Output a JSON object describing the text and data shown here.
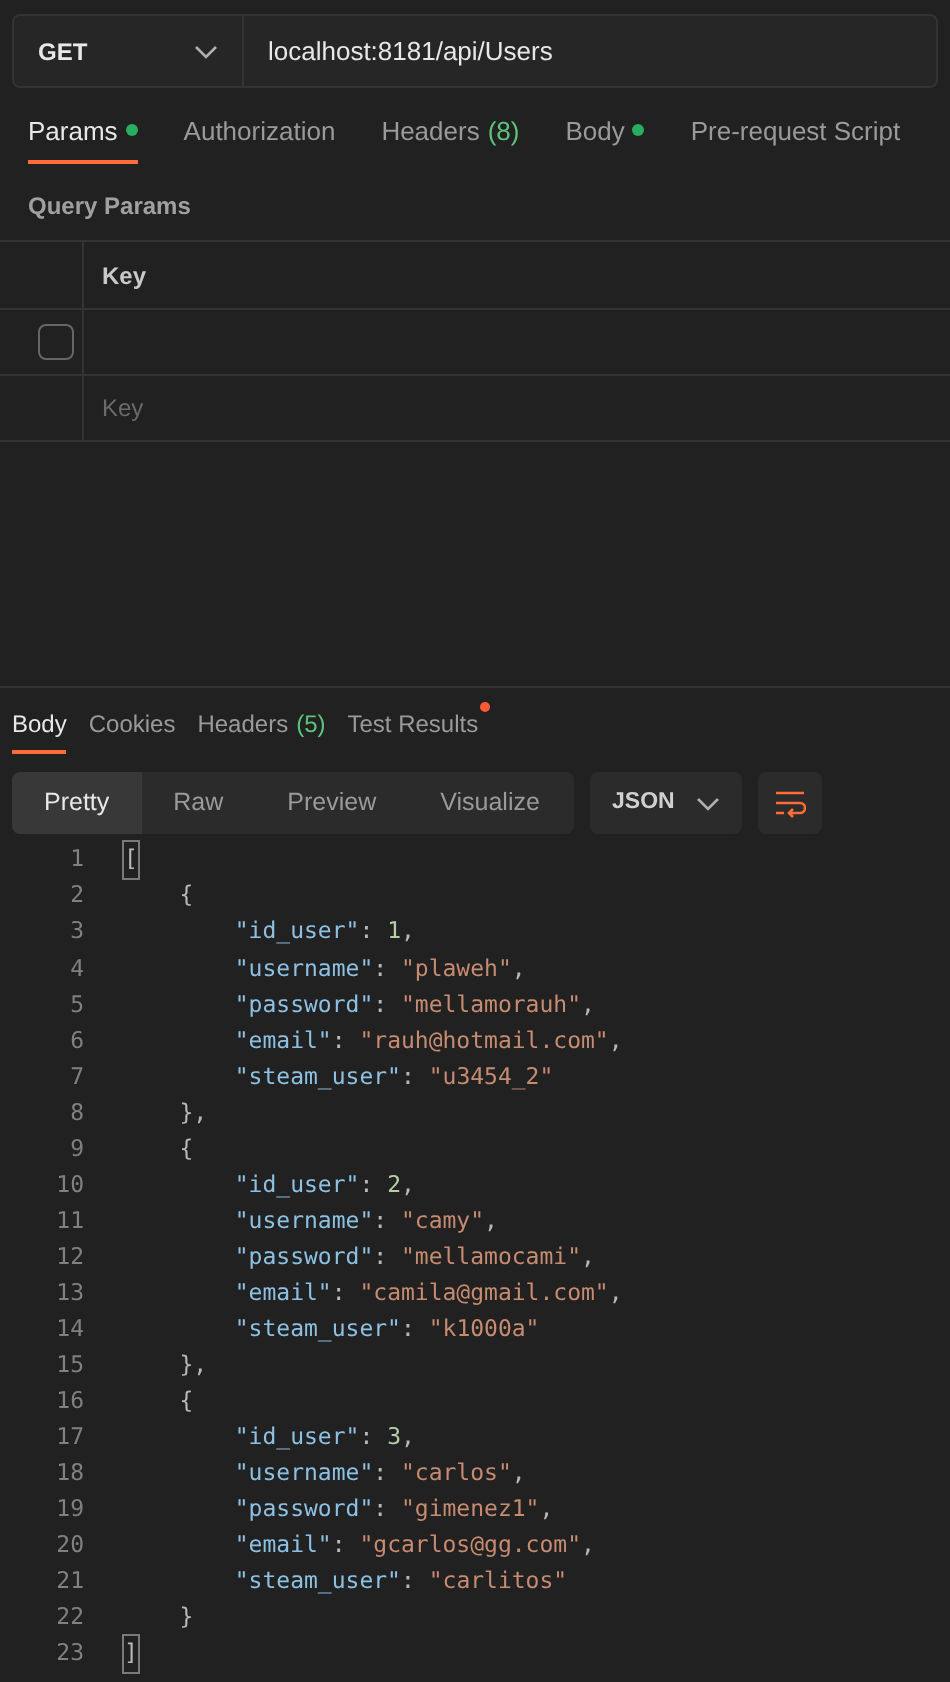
{
  "request": {
    "method": "GET",
    "url": "localhost:8181/api/Users"
  },
  "request_tabs": [
    {
      "label": "Params",
      "dot": true,
      "selected": true
    },
    {
      "label": "Authorization",
      "dot": false,
      "selected": false
    },
    {
      "label": "Headers",
      "count": "(8)",
      "dot": false,
      "selected": false
    },
    {
      "label": "Body",
      "dot": true,
      "selected": false
    },
    {
      "label": "Pre-request Script",
      "dot": false,
      "selected": false
    }
  ],
  "query_params": {
    "title": "Query Params",
    "columns": [
      "Key"
    ],
    "rows": [
      {
        "checked": false,
        "key": ""
      }
    ],
    "placeholder": "Key"
  },
  "response_tabs": [
    {
      "label": "Body",
      "alert": false,
      "selected": true
    },
    {
      "label": "Cookies",
      "alert": false,
      "selected": false
    },
    {
      "label": "Headers",
      "count": "(5)",
      "alert": false,
      "selected": false
    },
    {
      "label": "Test Results",
      "alert": true,
      "selected": false
    }
  ],
  "view_modes": [
    {
      "label": "Pretty",
      "selected": true
    },
    {
      "label": "Raw",
      "selected": false
    },
    {
      "label": "Preview",
      "selected": false
    },
    {
      "label": "Visualize",
      "selected": false
    }
  ],
  "format": "JSON",
  "code_lines": [
    {
      "number": "1",
      "tokens": [
        {
          "kind": "bracket",
          "text": "["
        }
      ]
    },
    {
      "number": "2",
      "tokens": [
        {
          "kind": "punct",
          "text": "    {"
        }
      ]
    },
    {
      "number": "3",
      "tokens": [
        {
          "kind": "key",
          "text": "        \"id_user\""
        },
        {
          "kind": "punct",
          "text": ": "
        },
        {
          "kind": "number",
          "text": "1"
        },
        {
          "kind": "punct",
          "text": ","
        }
      ]
    },
    {
      "number": "4",
      "tokens": [
        {
          "kind": "key",
          "text": "        \"username\""
        },
        {
          "kind": "punct",
          "text": ": "
        },
        {
          "kind": "string",
          "text": "\"plaweh\""
        },
        {
          "kind": "punct",
          "text": ","
        }
      ]
    },
    {
      "number": "5",
      "tokens": [
        {
          "kind": "key",
          "text": "        \"password\""
        },
        {
          "kind": "punct",
          "text": ": "
        },
        {
          "kind": "string",
          "text": "\"mellamorauh\""
        },
        {
          "kind": "punct",
          "text": ","
        }
      ]
    },
    {
      "number": "6",
      "tokens": [
        {
          "kind": "key",
          "text": "        \"email\""
        },
        {
          "kind": "punct",
          "text": ": "
        },
        {
          "kind": "string",
          "text": "\"rauh@hotmail.com\""
        },
        {
          "kind": "punct",
          "text": ","
        }
      ]
    },
    {
      "number": "7",
      "tokens": [
        {
          "kind": "key",
          "text": "        \"steam_user\""
        },
        {
          "kind": "punct",
          "text": ": "
        },
        {
          "kind": "string",
          "text": "\"u3454_2\""
        }
      ]
    },
    {
      "number": "8",
      "tokens": [
        {
          "kind": "punct",
          "text": "    },"
        }
      ]
    },
    {
      "number": "9",
      "tokens": [
        {
          "kind": "punct",
          "text": "    {"
        }
      ]
    },
    {
      "number": "10",
      "tokens": [
        {
          "kind": "key",
          "text": "        \"id_user\""
        },
        {
          "kind": "punct",
          "text": ": "
        },
        {
          "kind": "number",
          "text": "2"
        },
        {
          "kind": "punct",
          "text": ","
        }
      ]
    },
    {
      "number": "11",
      "tokens": [
        {
          "kind": "key",
          "text": "        \"username\""
        },
        {
          "kind": "punct",
          "text": ": "
        },
        {
          "kind": "string",
          "text": "\"camy\""
        },
        {
          "kind": "punct",
          "text": ","
        }
      ]
    },
    {
      "number": "12",
      "tokens": [
        {
          "kind": "key",
          "text": "        \"password\""
        },
        {
          "kind": "punct",
          "text": ": "
        },
        {
          "kind": "string",
          "text": "\"mellamocami\""
        },
        {
          "kind": "punct",
          "text": ","
        }
      ]
    },
    {
      "number": "13",
      "tokens": [
        {
          "kind": "key",
          "text": "        \"email\""
        },
        {
          "kind": "punct",
          "text": ": "
        },
        {
          "kind": "string",
          "text": "\"camila@gmail.com\""
        },
        {
          "kind": "punct",
          "text": ","
        }
      ]
    },
    {
      "number": "14",
      "tokens": [
        {
          "kind": "key",
          "text": "        \"steam_user\""
        },
        {
          "kind": "punct",
          "text": ": "
        },
        {
          "kind": "string",
          "text": "\"k1000a\""
        }
      ]
    },
    {
      "number": "15",
      "tokens": [
        {
          "kind": "punct",
          "text": "    },"
        }
      ]
    },
    {
      "number": "16",
      "tokens": [
        {
          "kind": "punct",
          "text": "    {"
        }
      ]
    },
    {
      "number": "17",
      "tokens": [
        {
          "kind": "key",
          "text": "        \"id_user\""
        },
        {
          "kind": "punct",
          "text": ": "
        },
        {
          "kind": "number",
          "text": "3"
        },
        {
          "kind": "punct",
          "text": ","
        }
      ]
    },
    {
      "number": "18",
      "tokens": [
        {
          "kind": "key",
          "text": "        \"username\""
        },
        {
          "kind": "punct",
          "text": ": "
        },
        {
          "kind": "string",
          "text": "\"carlos\""
        },
        {
          "kind": "punct",
          "text": ","
        }
      ]
    },
    {
      "number": "19",
      "tokens": [
        {
          "kind": "key",
          "text": "        \"password\""
        },
        {
          "kind": "punct",
          "text": ": "
        },
        {
          "kind": "string",
          "text": "\"gimenez1\""
        },
        {
          "kind": "punct",
          "text": ","
        }
      ]
    },
    {
      "number": "20",
      "tokens": [
        {
          "kind": "key",
          "text": "        \"email\""
        },
        {
          "kind": "punct",
          "text": ": "
        },
        {
          "kind": "string",
          "text": "\"gcarlos@gg.com\""
        },
        {
          "kind": "punct",
          "text": ","
        }
      ]
    },
    {
      "number": "21",
      "tokens": [
        {
          "kind": "key",
          "text": "        \"steam_user\""
        },
        {
          "kind": "punct",
          "text": ": "
        },
        {
          "kind": "string",
          "text": "\"carlitos\""
        }
      ]
    },
    {
      "number": "22",
      "tokens": [
        {
          "kind": "punct",
          "text": "    }"
        }
      ]
    },
    {
      "number": "23",
      "tokens": [
        {
          "kind": "bracket",
          "text": "]"
        }
      ]
    }
  ]
}
